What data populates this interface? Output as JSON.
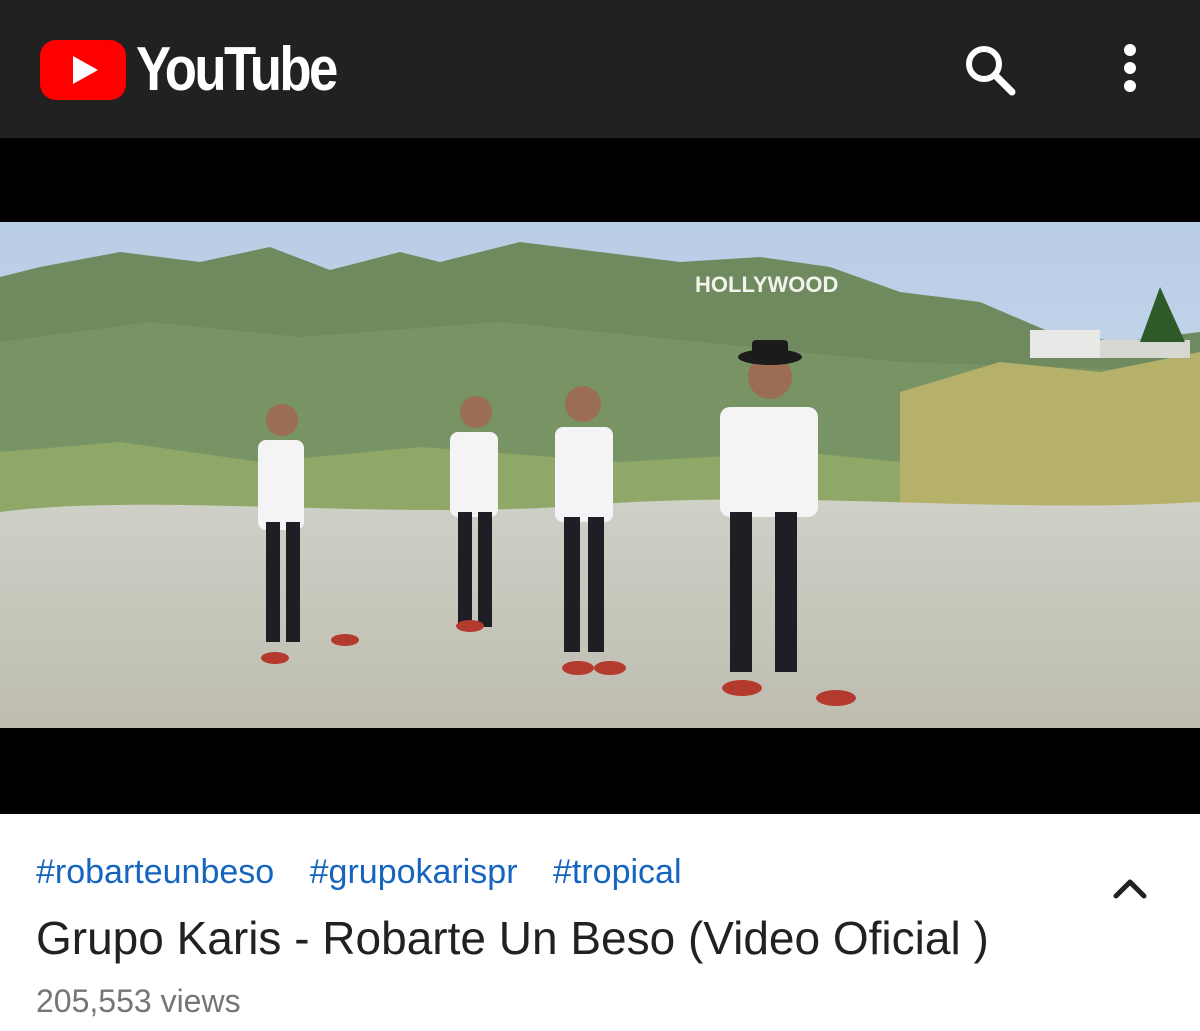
{
  "app": {
    "name": "YouTube"
  },
  "colors": {
    "topbar": "#212121",
    "brand_red": "#ff0000",
    "hashtag": "#1565c0",
    "title": "#212121",
    "meta": "#757575"
  },
  "header": {
    "logo_text": "YouTube",
    "icons": [
      "youtube-logo-icon",
      "search-icon",
      "more-vert-icon"
    ]
  },
  "video": {
    "sign_text": "HOLLYWOOD",
    "hashtags": [
      "#robarteunbeso",
      "#grupokarispr",
      "#tropical"
    ],
    "title": "Grupo Karis - Robarte Un Beso (Video Oficial )",
    "views": "205,553 views",
    "expand_icon": "chevron-up-icon"
  }
}
